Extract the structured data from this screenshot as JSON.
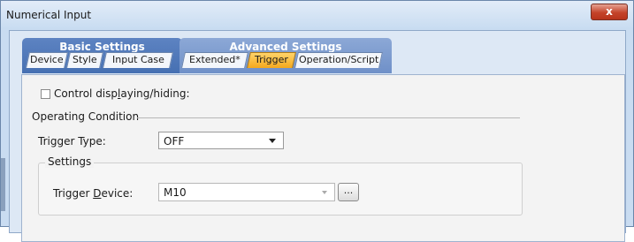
{
  "window": {
    "title": "Numerical Input",
    "close_symbol": "x"
  },
  "tabs": {
    "basic_group": "Basic Settings",
    "advanced_group": "Advanced Settings",
    "basic": [
      {
        "label": "Device"
      },
      {
        "label": "Style"
      },
      {
        "label": "Input Case"
      }
    ],
    "advanced": [
      {
        "label": "Extended*"
      },
      {
        "label": "Trigger",
        "active": true
      },
      {
        "label": "Operation/Script"
      }
    ]
  },
  "form": {
    "control_display_pre": "Control disp",
    "control_display_u": "l",
    "control_display_post": "aying/hiding:",
    "operating_condition": "Operating Condition",
    "trigger_type_label": "Trigger Type:",
    "trigger_type_value": "OFF",
    "settings_label": "Settings",
    "trigger_device_pre": "Trigger ",
    "trigger_device_u": "D",
    "trigger_device_post": "evice:",
    "trigger_device_value": "M10",
    "browse_label": "..."
  },
  "colors": {
    "basic_group": "#4f78ba",
    "advanced_group": "#7e9ccf",
    "active_tab": "#f4a81d",
    "close_button": "#c4432a"
  }
}
